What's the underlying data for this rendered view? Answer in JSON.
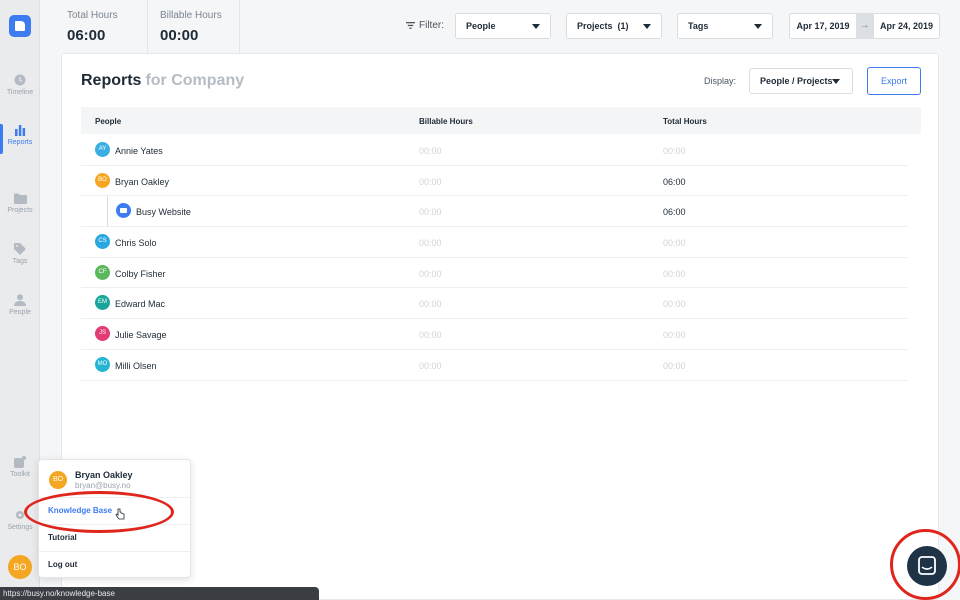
{
  "sidebar": {
    "items": [
      {
        "label": "Timeline",
        "icon": "clock-icon"
      },
      {
        "label": "Reports",
        "icon": "bar-chart-icon",
        "active": true
      },
      {
        "label": "Projects",
        "icon": "folder-icon"
      },
      {
        "label": "Tags",
        "icon": "tag-icon"
      },
      {
        "label": "People",
        "icon": "person-icon"
      },
      {
        "label": "Toolkit",
        "icon": "toolkit-icon"
      },
      {
        "label": "Settings",
        "icon": "gear-icon"
      }
    ],
    "user_initials": "BO"
  },
  "stats": {
    "total_label": "Total Hours",
    "total_value": "06:00",
    "billable_label": "Billable Hours",
    "billable_value": "00:00"
  },
  "filters": {
    "label": "Filter:",
    "people": "People",
    "projects": "Projects  (1)",
    "tags": "Tags",
    "date_start": "Apr 17, 2019",
    "date_arrow": "→",
    "date_end": "Apr 24, 2019"
  },
  "report": {
    "title": "Reports",
    "subtitle": "for Company",
    "display_label": "Display:",
    "display_value": "People / Projects",
    "export_label": "Export",
    "columns": [
      "People",
      "Billable Hours",
      "Total Hours"
    ],
    "rows": [
      {
        "initials": "AY",
        "name": "Annie Yates",
        "billable": "00:00",
        "total": "00:00",
        "color": "#3aaee0"
      },
      {
        "initials": "BO",
        "name": "Bryan Oakley",
        "billable": "00:00",
        "total": "06:00",
        "color": "#f5a623"
      },
      {
        "initials": "",
        "name": "Busy Website",
        "billable": "00:00",
        "total": "06:00",
        "color": "#3d7bf0",
        "sub": true
      },
      {
        "initials": "CS",
        "name": "Chris Solo",
        "billable": "00:00",
        "total": "00:00",
        "color": "#29a8e0"
      },
      {
        "initials": "CF",
        "name": "Colby Fisher",
        "billable": "00:00",
        "total": "00:00",
        "color": "#5cb85c"
      },
      {
        "initials": "EM",
        "name": "Edward Mac",
        "billable": "00:00",
        "total": "00:00",
        "color": "#1aa59a"
      },
      {
        "initials": "JS",
        "name": "Julie Savage",
        "billable": "00:00",
        "total": "00:00",
        "color": "#e23b75"
      },
      {
        "initials": "MO",
        "name": "Milli Olsen",
        "billable": "00:00",
        "total": "00:00",
        "color": "#23b5d3"
      }
    ]
  },
  "user_menu": {
    "initials": "BO",
    "name": "Bryan Oakley",
    "email": "bryan@busy.no",
    "items": [
      "Knowledge Base",
      "Tutorial",
      "Log out"
    ]
  },
  "status_bar_url": "https://busy.no/knowledge-base",
  "colors": {
    "accent": "#3d7bf0",
    "highlight": "#e0261c",
    "chat": "#1f3347"
  }
}
